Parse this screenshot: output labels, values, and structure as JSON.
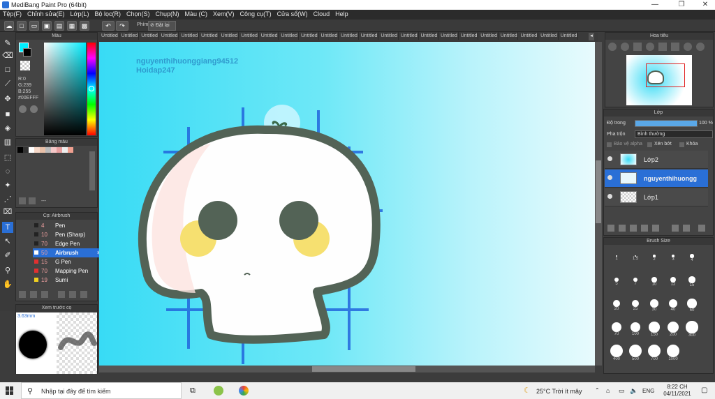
{
  "window": {
    "title": "MediBang Paint Pro (64bit)"
  },
  "menu": [
    "Tệp(F)",
    "Chỉnh sửa(E)",
    "Lớp(L)",
    "Bộ lọc(R)",
    "Chọn(S)",
    "Chụp(N)",
    "Màu (C)",
    "Xem(V)",
    "Công cụ(T)",
    "Cửa sổ(W)",
    "Cloud",
    "Help"
  ],
  "toolbar": {
    "snap_label": "Phím",
    "reset_label": "Đặt lại"
  },
  "color_panel": {
    "title": "Màu",
    "r": "R:0",
    "g": "G:239",
    "b": "B:255",
    "hex": "#00EFFF",
    "current_color": "#00efff"
  },
  "palette": {
    "title": "Bảng màu",
    "status": "---"
  },
  "brush_panel": {
    "title": "Cọ: Airbrush",
    "items": [
      {
        "size": "4",
        "name": "Pen",
        "color": "#222222"
      },
      {
        "size": "10",
        "name": "Pen (Sharp)",
        "color": "#222222"
      },
      {
        "size": "70",
        "name": "Edge Pen",
        "color": "#222222"
      },
      {
        "size": "50",
        "name": "Airbrush",
        "color": "#ffffff",
        "selected": true
      },
      {
        "size": "15",
        "name": "G Pen",
        "color": "#e03030"
      },
      {
        "size": "70",
        "name": "Mapping Pen",
        "color": "#e03030"
      },
      {
        "size": "19",
        "name": "Sumi",
        "color": "#f0d020"
      }
    ]
  },
  "preview_panel": {
    "title": "Xem trước cọ",
    "size_label": "3.63mm"
  },
  "tabs": [
    "Untitled",
    "Untitled",
    "Untitled",
    "Untitled",
    "Untitled",
    "Untitled",
    "Untitled",
    "Untitled",
    "Untitled",
    "Untitled",
    "Untitled",
    "Untitled",
    "Untitled",
    "Untitled",
    "Untitled",
    "Untitled",
    "Untitled",
    "Untitled",
    "Untitled",
    "Untitled",
    "Untitled",
    "Untitled",
    "Untitled",
    "Untitled",
    "Untitled"
  ],
  "canvas": {
    "watermark_line1": "nguyenthihuonggiang94512",
    "watermark_line2": "Hoidap247"
  },
  "navigator": {
    "title": "Hoa tiêu"
  },
  "layer_panel": {
    "title": "Lớp",
    "opacity_label": "Độ trong",
    "opacity_value": "100 %",
    "opacity_fraction": 1.0,
    "blend_label": "Pha trộn",
    "blend_value": "Bình thường",
    "alpha_protect": "Bảo vệ alpha",
    "clipping": "Xén bớt",
    "lock": "Khóa",
    "layers": [
      {
        "name": "Lớp2",
        "selected": false
      },
      {
        "name": "nguyenthihuongg",
        "selected": true
      },
      {
        "name": "Lớp1",
        "selected": false
      }
    ]
  },
  "brush_size_panel": {
    "title": "Brush Size",
    "sizes": [
      "1",
      "1.5",
      "2",
      "3",
      "4",
      "5",
      "7",
      "10",
      "12",
      "15",
      "20",
      "25",
      "30",
      "40",
      "50",
      "70",
      "100",
      "150",
      "200",
      "300",
      "400",
      "500",
      "700",
      "1000"
    ]
  },
  "taskbar": {
    "search_placeholder": "Nhập tại đây để tìm kiếm",
    "weather": "25°C  Trời ít mây",
    "language": "ENG",
    "time": "8:22 CH",
    "date": "04/11/2021"
  }
}
